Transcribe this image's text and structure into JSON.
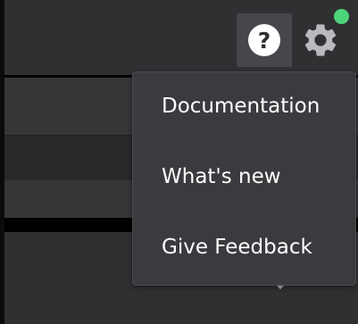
{
  "header": {
    "help_glyph": "?",
    "help_icon": "question-circle-icon",
    "settings_icon": "gear-icon",
    "status_color": "#4cd47a"
  },
  "help_menu": {
    "items": [
      {
        "label": "Documentation"
      },
      {
        "label": "What's new"
      },
      {
        "label": "Give Feedback"
      }
    ]
  },
  "colors": {
    "background": "#2f3032",
    "menu_background": "#3a3b3e",
    "active_button": "#46474a",
    "text": "#ffffff"
  }
}
